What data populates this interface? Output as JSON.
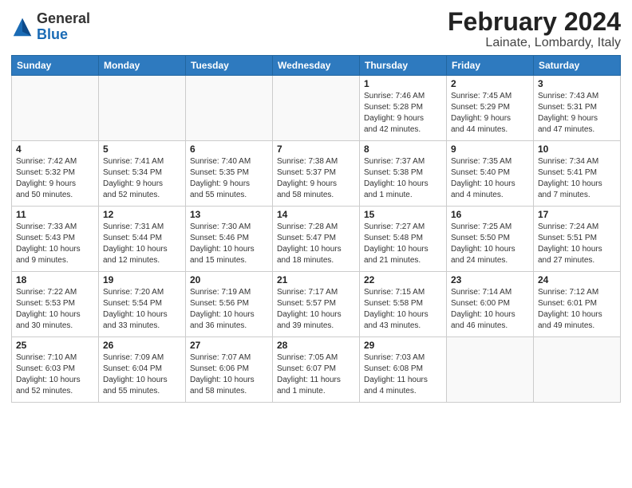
{
  "header": {
    "logo_line1": "General",
    "logo_line2": "Blue",
    "title": "February 2024",
    "subtitle": "Lainate, Lombardy, Italy"
  },
  "weekdays": [
    "Sunday",
    "Monday",
    "Tuesday",
    "Wednesday",
    "Thursday",
    "Friday",
    "Saturday"
  ],
  "weeks": [
    [
      {
        "day": "",
        "info": ""
      },
      {
        "day": "",
        "info": ""
      },
      {
        "day": "",
        "info": ""
      },
      {
        "day": "",
        "info": ""
      },
      {
        "day": "1",
        "info": "Sunrise: 7:46 AM\nSunset: 5:28 PM\nDaylight: 9 hours\nand 42 minutes."
      },
      {
        "day": "2",
        "info": "Sunrise: 7:45 AM\nSunset: 5:29 PM\nDaylight: 9 hours\nand 44 minutes."
      },
      {
        "day": "3",
        "info": "Sunrise: 7:43 AM\nSunset: 5:31 PM\nDaylight: 9 hours\nand 47 minutes."
      }
    ],
    [
      {
        "day": "4",
        "info": "Sunrise: 7:42 AM\nSunset: 5:32 PM\nDaylight: 9 hours\nand 50 minutes."
      },
      {
        "day": "5",
        "info": "Sunrise: 7:41 AM\nSunset: 5:34 PM\nDaylight: 9 hours\nand 52 minutes."
      },
      {
        "day": "6",
        "info": "Sunrise: 7:40 AM\nSunset: 5:35 PM\nDaylight: 9 hours\nand 55 minutes."
      },
      {
        "day": "7",
        "info": "Sunrise: 7:38 AM\nSunset: 5:37 PM\nDaylight: 9 hours\nand 58 minutes."
      },
      {
        "day": "8",
        "info": "Sunrise: 7:37 AM\nSunset: 5:38 PM\nDaylight: 10 hours\nand 1 minute."
      },
      {
        "day": "9",
        "info": "Sunrise: 7:35 AM\nSunset: 5:40 PM\nDaylight: 10 hours\nand 4 minutes."
      },
      {
        "day": "10",
        "info": "Sunrise: 7:34 AM\nSunset: 5:41 PM\nDaylight: 10 hours\nand 7 minutes."
      }
    ],
    [
      {
        "day": "11",
        "info": "Sunrise: 7:33 AM\nSunset: 5:43 PM\nDaylight: 10 hours\nand 9 minutes."
      },
      {
        "day": "12",
        "info": "Sunrise: 7:31 AM\nSunset: 5:44 PM\nDaylight: 10 hours\nand 12 minutes."
      },
      {
        "day": "13",
        "info": "Sunrise: 7:30 AM\nSunset: 5:46 PM\nDaylight: 10 hours\nand 15 minutes."
      },
      {
        "day": "14",
        "info": "Sunrise: 7:28 AM\nSunset: 5:47 PM\nDaylight: 10 hours\nand 18 minutes."
      },
      {
        "day": "15",
        "info": "Sunrise: 7:27 AM\nSunset: 5:48 PM\nDaylight: 10 hours\nand 21 minutes."
      },
      {
        "day": "16",
        "info": "Sunrise: 7:25 AM\nSunset: 5:50 PM\nDaylight: 10 hours\nand 24 minutes."
      },
      {
        "day": "17",
        "info": "Sunrise: 7:24 AM\nSunset: 5:51 PM\nDaylight: 10 hours\nand 27 minutes."
      }
    ],
    [
      {
        "day": "18",
        "info": "Sunrise: 7:22 AM\nSunset: 5:53 PM\nDaylight: 10 hours\nand 30 minutes."
      },
      {
        "day": "19",
        "info": "Sunrise: 7:20 AM\nSunset: 5:54 PM\nDaylight: 10 hours\nand 33 minutes."
      },
      {
        "day": "20",
        "info": "Sunrise: 7:19 AM\nSunset: 5:56 PM\nDaylight: 10 hours\nand 36 minutes."
      },
      {
        "day": "21",
        "info": "Sunrise: 7:17 AM\nSunset: 5:57 PM\nDaylight: 10 hours\nand 39 minutes."
      },
      {
        "day": "22",
        "info": "Sunrise: 7:15 AM\nSunset: 5:58 PM\nDaylight: 10 hours\nand 43 minutes."
      },
      {
        "day": "23",
        "info": "Sunrise: 7:14 AM\nSunset: 6:00 PM\nDaylight: 10 hours\nand 46 minutes."
      },
      {
        "day": "24",
        "info": "Sunrise: 7:12 AM\nSunset: 6:01 PM\nDaylight: 10 hours\nand 49 minutes."
      }
    ],
    [
      {
        "day": "25",
        "info": "Sunrise: 7:10 AM\nSunset: 6:03 PM\nDaylight: 10 hours\nand 52 minutes."
      },
      {
        "day": "26",
        "info": "Sunrise: 7:09 AM\nSunset: 6:04 PM\nDaylight: 10 hours\nand 55 minutes."
      },
      {
        "day": "27",
        "info": "Sunrise: 7:07 AM\nSunset: 6:06 PM\nDaylight: 10 hours\nand 58 minutes."
      },
      {
        "day": "28",
        "info": "Sunrise: 7:05 AM\nSunset: 6:07 PM\nDaylight: 11 hours\nand 1 minute."
      },
      {
        "day": "29",
        "info": "Sunrise: 7:03 AM\nSunset: 6:08 PM\nDaylight: 11 hours\nand 4 minutes."
      },
      {
        "day": "",
        "info": ""
      },
      {
        "day": "",
        "info": ""
      }
    ]
  ]
}
